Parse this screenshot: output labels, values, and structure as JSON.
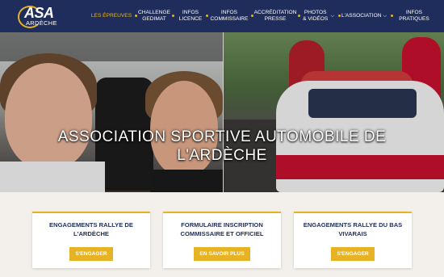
{
  "logo": {
    "main": "ASA",
    "sub": "ARDÈCHE"
  },
  "nav": {
    "items": [
      {
        "label": "LES ÉPREUVES",
        "active": true
      },
      {
        "label": "CHALLENGE GEDIMAT",
        "active": false
      },
      {
        "label": "INFOS LICENCE",
        "active": false
      },
      {
        "label": "INFOS COMMISSAIRE",
        "active": false
      },
      {
        "label": "ACCRÉDITATION PRESSE",
        "active": false
      },
      {
        "label": "PHOTOS & VIDÉOS",
        "active": false,
        "dropdown": true
      },
      {
        "label": "L'ASSOCIATION",
        "active": false,
        "dropdown": true
      },
      {
        "label": "INFOS PRATIQUES",
        "active": false
      }
    ]
  },
  "hero": {
    "title": "ASSOCIATION SPORTIVE AUTOMOBILE DE L'ARDÈCHE"
  },
  "cards": [
    {
      "title": "ENGAGEMENTS RALLYE DE L'ARDÈCHE",
      "button": "S'ENGAGER"
    },
    {
      "title": "FORMULAIRE INSCRIPTION COMMISSAIRE ET OFFICIEL",
      "button": "EN SAVOIR PLUS"
    },
    {
      "title": "ENGAGEMENTS RALLYE DU BAS VIVARAIS",
      "button": "S'ENGAGER"
    }
  ],
  "colors": {
    "header_bg": "#1e2d5c",
    "accent": "#e6b325",
    "card_title": "#1e2d5c"
  },
  "icons": {
    "dropdown": "chevron-down-icon"
  }
}
